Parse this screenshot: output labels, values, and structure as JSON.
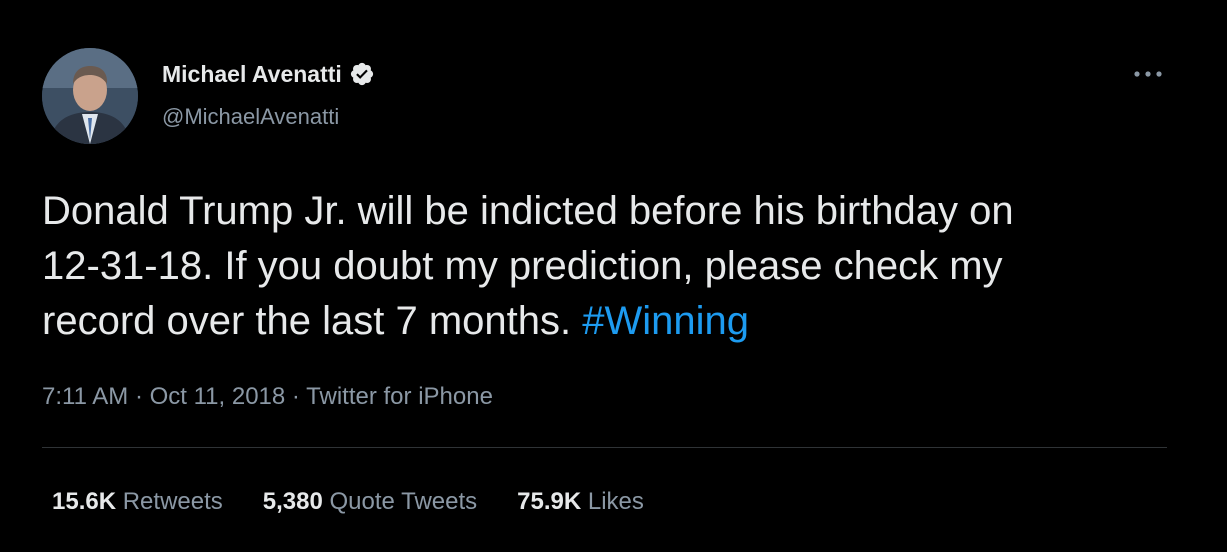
{
  "author": {
    "display_name": "Michael Avenatti",
    "handle": "@MichaelAvenatti",
    "verified": true,
    "avatar_icon": "profile-photo"
  },
  "tweet": {
    "line1": "Donald Trump Jr. will be indicted before his birthday on",
    "line2": "12-31-18. If you doubt my prediction, please check my",
    "line3": "record over the last 7 months. ",
    "hashtag": "#Winning"
  },
  "meta": {
    "time": "7:11 AM",
    "separator1": " · ",
    "date": "Oct 11, 2018",
    "separator2": " · ",
    "source": "Twitter for iPhone"
  },
  "stats": {
    "retweets_count": "15.6K",
    "retweets_label": "Retweets",
    "quotes_count": "5,380",
    "quotes_label": "Quote Tweets",
    "likes_count": "75.9K",
    "likes_label": "Likes"
  },
  "colors": {
    "background": "#000000",
    "text": "#e7e9ea",
    "secondary": "#8b98a5",
    "link": "#1d9bf0",
    "verified_badge": "#e7e9ea"
  },
  "icons": {
    "more": "more-horizontal-icon",
    "verified": "verified-badge-icon"
  }
}
